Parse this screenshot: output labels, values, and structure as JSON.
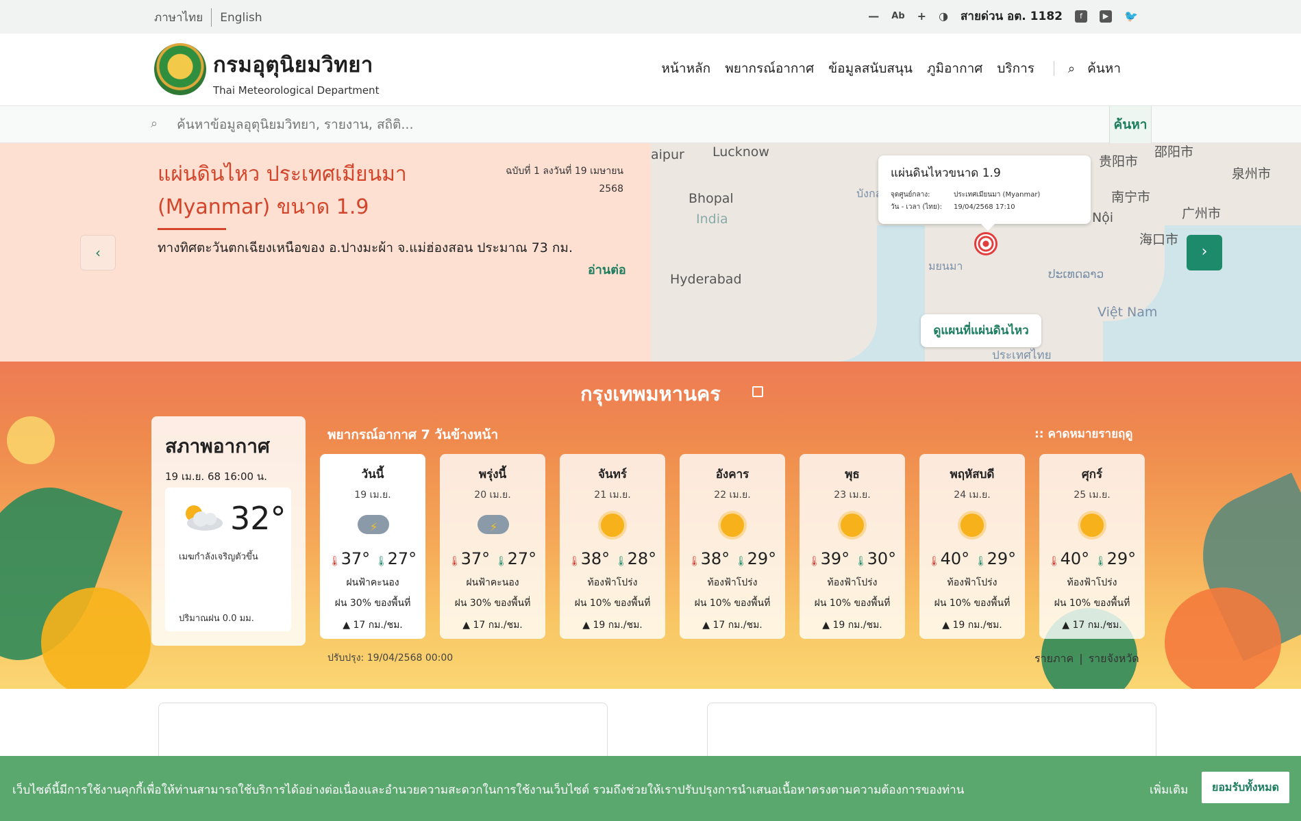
{
  "topbar": {
    "lang_th": "ภาษาไทย",
    "lang_en": "English",
    "zoom_out": "—",
    "text_label": "Ab",
    "zoom_in": "+",
    "contrast": "◑",
    "hotline": "สายด่วน อต. 1182"
  },
  "header": {
    "brand_th": "กรมอุตุนิยมวิทยา",
    "brand_en": "Thai Meteorological Department",
    "nav": [
      "หน้าหลัก",
      "พยากรณ์อากาศ",
      "ข้อมูลสนับสนุน",
      "ภูมิอากาศ",
      "บริการ"
    ],
    "search_label": "ค้นหา"
  },
  "search": {
    "placeholder": "ค้นหาข้อมูลอุตุนิยมวิทยา, รายงาน, สถิติ...",
    "button": "ค้นหา"
  },
  "quake": {
    "title": "แผ่นดินไหว ประเทศเมียนมา (Myanmar) ขนาด 1.9",
    "issue": "ฉบับที่ 1 ลงวันที่ 19 เมษายน 2568",
    "description": "ทางทิศตะวันตกเฉียงเหนือของ อ.ปางมะผ้า จ.แม่ฮ่องสอน ประมาณ 73 กม.",
    "read_more": "อ่านต่อ",
    "popup_title": "แผ่นดินไหวขนาด 1.9",
    "popup_center_label": "จุดศูนย์กลาง:",
    "popup_center_value": "ประเทศเมียนมา (Myanmar)",
    "popup_time_label": "วัน - เวลา (ไทย):",
    "popup_time_value": "19/04/2568 17:10",
    "map_button": "ดูแผนที่แผ่นดินไหว",
    "map_labels": [
      "aipur",
      "Lucknow",
      "Bhopal",
      "India",
      "Hyderabad",
      "贵阳市",
      "邵阳市",
      "泉州市",
      "南宁市",
      "广州市",
      "Hà Nội",
      "海口市",
      "ປະເທດລາວ",
      "Việt Nam",
      "ประเทศไทย",
      "บังกลาเทศ",
      "มยนมา"
    ]
  },
  "weather": {
    "city": "กรุงเทพมหานคร",
    "current_title": "สภาพอากาศ",
    "current_date": "19 เม.ย. 68 16:00 น.",
    "current_temp": "32°",
    "current_condition": "เมฆกำลังเจริญตัวขึ้น",
    "current_rain": "ปริมาณฝน 0.0 มม.",
    "forecast_heading": "พยากรณ์อากาศ 7 วันข้างหน้า",
    "season_link": ":: คาดหมายรายฤดู",
    "updated": "ปรับปรุง: 19/04/2568 00:00",
    "regional": "รายภาค",
    "provincial": "รายจังหวัด",
    "days": [
      {
        "day": "วันนี้",
        "date": "19 เม.ย.",
        "icon": "storm",
        "hi": "37°",
        "lo": "27°",
        "cond": "ฝนฟ้าคะนอง",
        "rain": "ฝน 30% ของพื้นที่",
        "wind": "17 กม./ชม."
      },
      {
        "day": "พรุ่งนี้",
        "date": "20 เม.ย.",
        "icon": "storm",
        "hi": "37°",
        "lo": "27°",
        "cond": "ฝนฟ้าคะนอง",
        "rain": "ฝน 30% ของพื้นที่",
        "wind": "17 กม./ชม."
      },
      {
        "day": "จันทร์",
        "date": "21 เม.ย.",
        "icon": "sun",
        "hi": "38°",
        "lo": "28°",
        "cond": "ท้องฟ้าโปร่ง",
        "rain": "ฝน 10% ของพื้นที่",
        "wind": "19 กม./ชม."
      },
      {
        "day": "อังคาร",
        "date": "22 เม.ย.",
        "icon": "sun",
        "hi": "38°",
        "lo": "29°",
        "cond": "ท้องฟ้าโปร่ง",
        "rain": "ฝน 10% ของพื้นที่",
        "wind": "17 กม./ชม."
      },
      {
        "day": "พุธ",
        "date": "23 เม.ย.",
        "icon": "sun",
        "hi": "39°",
        "lo": "30°",
        "cond": "ท้องฟ้าโปร่ง",
        "rain": "ฝน 10% ของพื้นที่",
        "wind": "19 กม./ชม."
      },
      {
        "day": "พฤหัสบดี",
        "date": "24 เม.ย.",
        "icon": "sun",
        "hi": "40°",
        "lo": "29°",
        "cond": "ท้องฟ้าโปร่ง",
        "rain": "ฝน 10% ของพื้นที่",
        "wind": "19 กม./ชม."
      },
      {
        "day": "ศุกร์",
        "date": "25 เม.ย.",
        "icon": "sun",
        "hi": "40°",
        "lo": "29°",
        "cond": "ท้องฟ้าโปร่ง",
        "rain": "ฝน 10% ของพื้นที่",
        "wind": "17 กม./ชม."
      }
    ]
  },
  "cookie": {
    "message": "เว็บไซต์นี้มีการใช้งานคุกกี้เพื่อให้ท่านสามารถใช้บริการได้อย่างต่อเนื่องและอำนวยความสะดวกในการใช้งานเว็บไซต์ รวมถึงช่วยให้เราปรับปรุงการนำเสนอเนื้อหาตรงตามความต้องการของท่าน",
    "more": "เพิ่มเติม",
    "accept": "ยอมรับทั้งหมด"
  },
  "colors": {
    "brand_green": "#1d7d5f",
    "quake_red": "#d3452b",
    "cookie_green": "#5aa86e"
  }
}
